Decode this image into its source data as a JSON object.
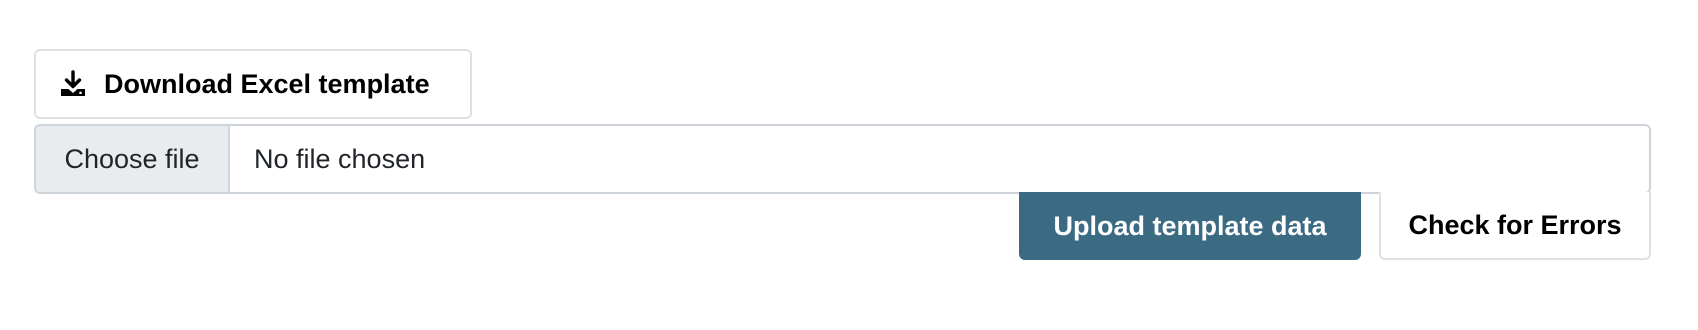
{
  "download": {
    "label": "Download Excel template",
    "icon": "download-icon"
  },
  "file_input": {
    "button_label": "Choose file",
    "status_text": "No file chosen"
  },
  "actions": {
    "upload_label": "Upload template data",
    "check_label": "Check for Errors"
  },
  "colors": {
    "upload_button_bg": "#3a6b82",
    "choose_file_bg": "#e9ecef",
    "border": "#ced4da"
  }
}
